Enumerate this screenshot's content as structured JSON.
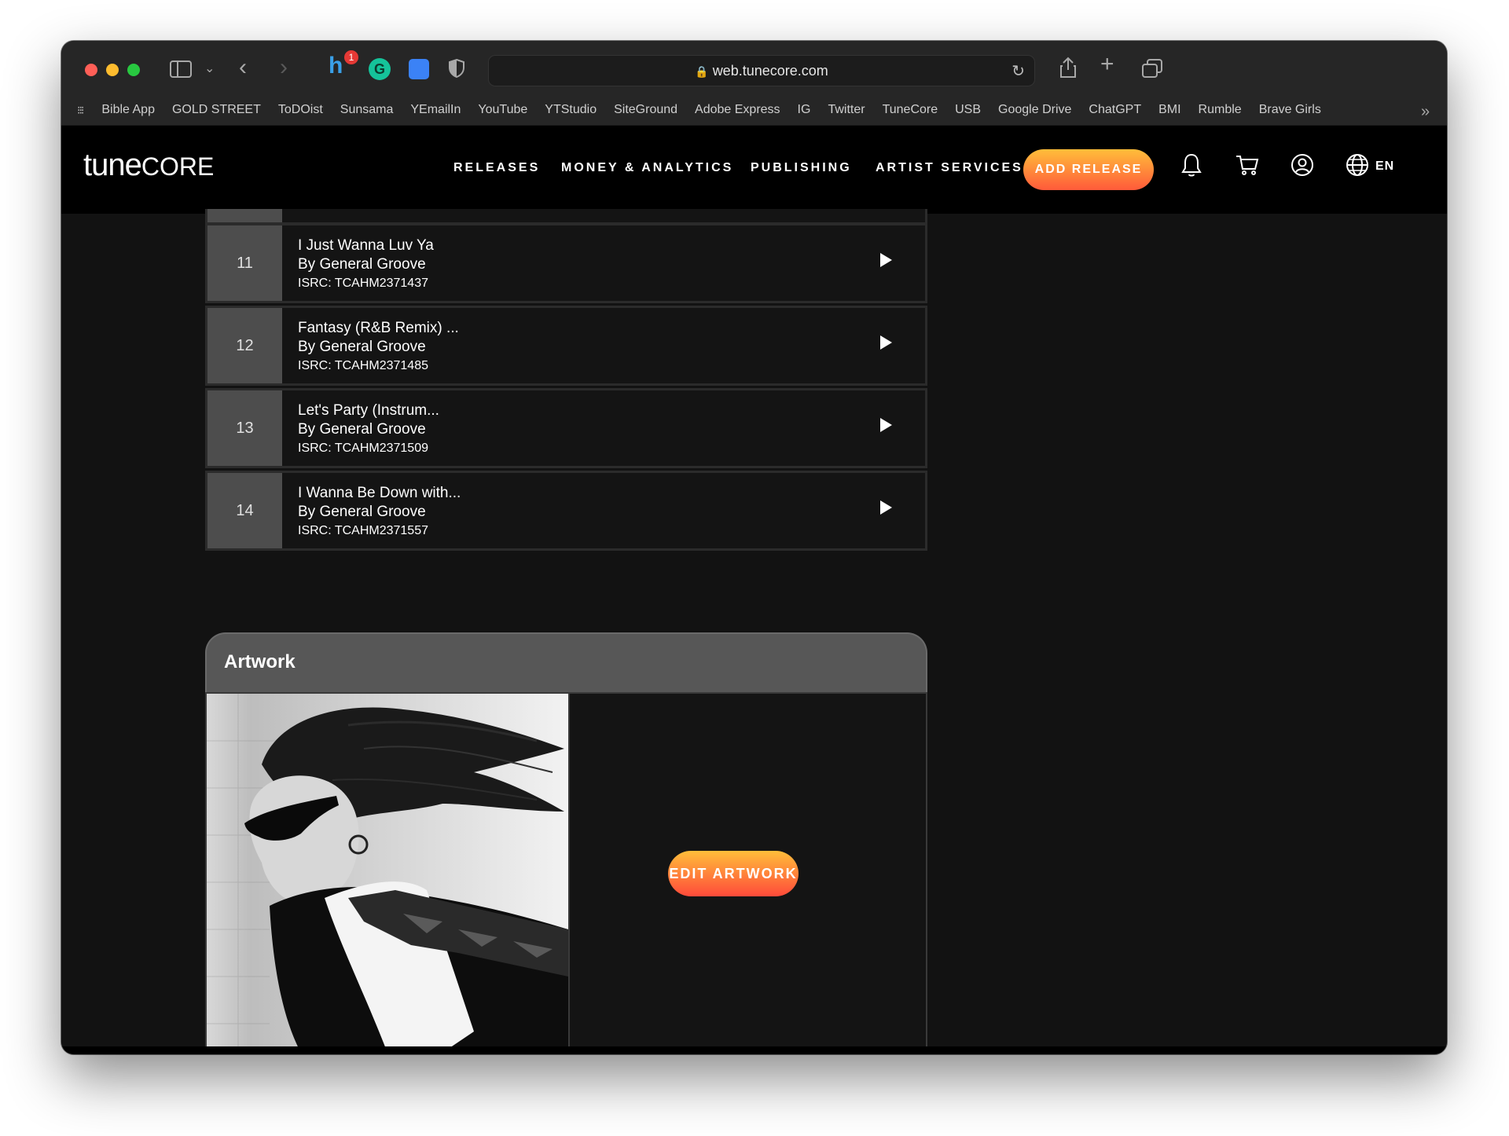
{
  "browser": {
    "url": "web.tunecore.com",
    "extension_badge": "1",
    "bookmarks": [
      "Bible App",
      "GOLD STREET",
      "ToDOist",
      "Sunsama",
      "YEmailIn",
      "YouTube",
      "YTStudio",
      "SiteGround",
      "Adobe Express",
      "IG",
      "Twitter",
      "TuneCore",
      "USB",
      "Google Drive",
      "ChatGPT",
      "BMI",
      "Rumble",
      "Brave Girls"
    ]
  },
  "header": {
    "logo_tune": "tune",
    "logo_core": "CORE",
    "nav": [
      "RELEASES",
      "MONEY & ANALYTICS",
      "PUBLISHING",
      "ARTIST SERVICES"
    ],
    "add_release_label": "ADD RELEASE",
    "language": "EN"
  },
  "tracks": [
    {
      "num": "11",
      "title": "I Just Wanna Luv Ya",
      "artist": "By General Groove",
      "isrc": "ISRC: TCAHM2371437"
    },
    {
      "num": "12",
      "title": "Fantasy (R&B Remix) ...",
      "artist": "By General Groove",
      "isrc": "ISRC: TCAHM2371485"
    },
    {
      "num": "13",
      "title": "Let's Party (Instrum...",
      "artist": "By General Groove",
      "isrc": "ISRC: TCAHM2371509"
    },
    {
      "num": "14",
      "title": "I Wanna Be Down with...",
      "artist": "By General Groove",
      "isrc": "ISRC: TCAHM2371557"
    }
  ],
  "artwork": {
    "title": "Artwork",
    "edit_label": "EDIT ARTWORK"
  }
}
